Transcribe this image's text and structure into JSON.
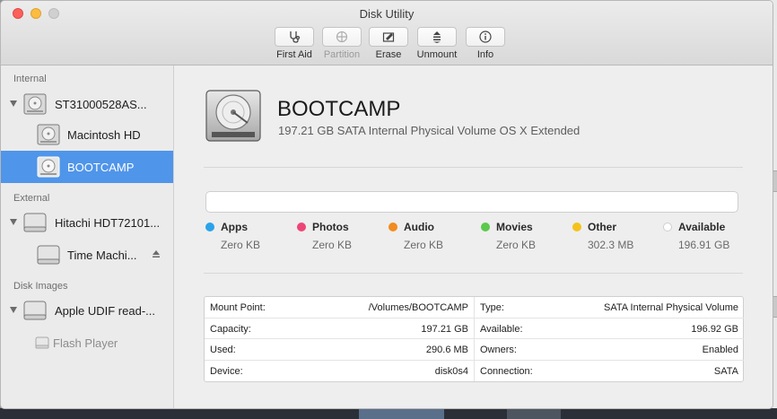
{
  "window": {
    "title": "Disk Utility"
  },
  "toolbar": {
    "items": [
      {
        "label": "First Aid",
        "icon": "stethoscope-icon",
        "enabled": true
      },
      {
        "label": "Partition",
        "icon": "partition-icon",
        "enabled": false
      },
      {
        "label": "Erase",
        "icon": "erase-icon",
        "enabled": true
      },
      {
        "label": "Unmount",
        "icon": "unmount-icon",
        "enabled": true
      },
      {
        "label": "Info",
        "icon": "info-icon",
        "enabled": true
      }
    ]
  },
  "sidebar": {
    "sections": {
      "internal": "Internal",
      "external": "External",
      "disk_images": "Disk Images"
    },
    "items": [
      {
        "label": "ST31000528AS...",
        "icon": "internal-disk-icon"
      },
      {
        "label": "Macintosh HD",
        "icon": "volume-icon"
      },
      {
        "label": "BOOTCAMP",
        "icon": "volume-icon",
        "selected": true
      },
      {
        "label": "Hitachi HDT72101...",
        "icon": "external-disk-icon"
      },
      {
        "label": "Time Machi...",
        "icon": "external-volume-icon"
      },
      {
        "label": "Apple UDIF read-...",
        "icon": "disk-image-icon"
      },
      {
        "label": "Flash Player",
        "icon": "small-volume-icon",
        "dimmed": true
      }
    ]
  },
  "volume": {
    "name": "BOOTCAMP",
    "description": "197.21 GB SATA Internal Physical Volume OS X Extended"
  },
  "usage": {
    "legend": [
      {
        "name": "Apps",
        "value": "Zero KB",
        "color": "#2aa3ea"
      },
      {
        "name": "Photos",
        "value": "Zero KB",
        "color": "#ee4577"
      },
      {
        "name": "Audio",
        "value": "Zero KB",
        "color": "#f28c1f"
      },
      {
        "name": "Movies",
        "value": "Zero KB",
        "color": "#5ac94c"
      },
      {
        "name": "Other",
        "value": "302.3 MB",
        "color": "#f5c21c"
      },
      {
        "name": "Available",
        "value": "196.91 GB",
        "color": "#ffffff"
      }
    ]
  },
  "info": {
    "left": [
      {
        "key": "Mount Point:",
        "value": "/Volumes/BOOTCAMP"
      },
      {
        "key": "Capacity:",
        "value": "197.21 GB"
      },
      {
        "key": "Used:",
        "value": "290.6 MB"
      },
      {
        "key": "Device:",
        "value": "disk0s4"
      }
    ],
    "right": [
      {
        "key": "Type:",
        "value": "SATA Internal Physical Volume"
      },
      {
        "key": "Available:",
        "value": "196.92 GB"
      },
      {
        "key": "Owners:",
        "value": "Enabled"
      },
      {
        "key": "Connection:",
        "value": "SATA"
      }
    ]
  }
}
